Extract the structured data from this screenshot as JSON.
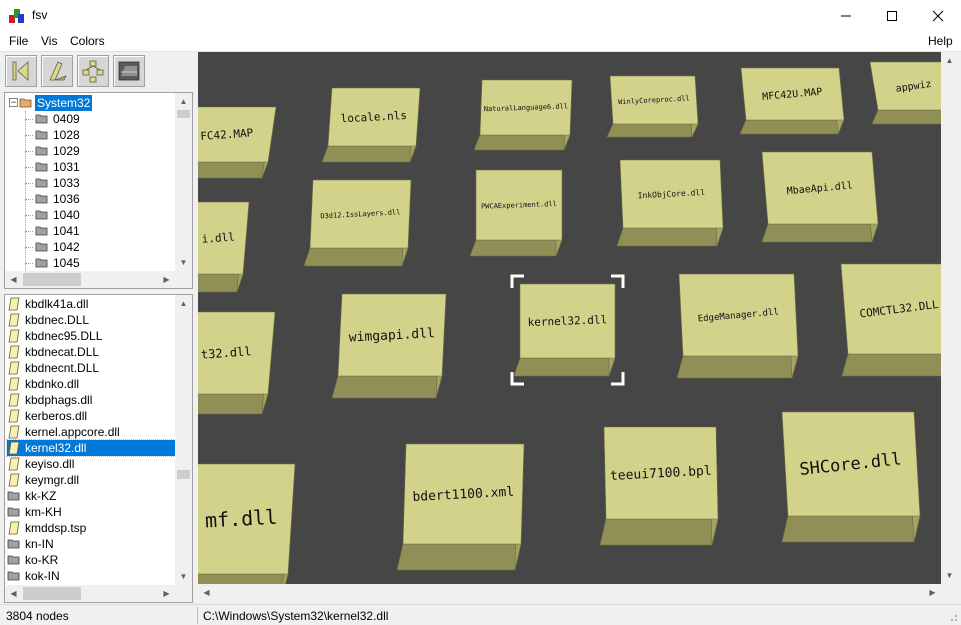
{
  "window": {
    "title": "fsv"
  },
  "menu": {
    "file": "File",
    "vis": "Vis",
    "colors": "Colors",
    "help": "Help"
  },
  "toolbar": {
    "icons": [
      "back-to-root-icon",
      "birdseye-view-icon",
      "cd-up-icon",
      "toggle-view-icon"
    ]
  },
  "tree": {
    "root": "System32",
    "children": [
      "0409",
      "1028",
      "1029",
      "1031",
      "1033",
      "1036",
      "1040",
      "1041",
      "1042",
      "1045"
    ]
  },
  "files": [
    "kbdlk41a.dll",
    "kbdnec.DLL",
    "kbdnec95.DLL",
    "kbdnecat.DLL",
    "kbdnecnt.DLL",
    "kbdnko.dll",
    "kbdphags.dll",
    "kerberos.dll",
    "kernel.appcore.dll",
    "kernel32.dll",
    "keyiso.dll",
    "keymgr.dll",
    "kk-KZ",
    "km-KH",
    "kmddsp.tsp",
    "kn-IN",
    "ko-KR",
    "kok-IN"
  ],
  "selected_file": "kernel32.dll",
  "scene": {
    "blocks": [
      "FC42.MAP",
      "locale.nls",
      "NaturalLanguage6.dll",
      "WinlyCoreproc.dll",
      "MFC42U.MAP",
      "appwiz",
      "i.dll",
      "D3d12.IssLayers.dll",
      "PWCAExperiment.dll",
      "InkObjCore.dll",
      "MbaeApi.dll",
      "t32.dll",
      "wimgapi.dll",
      "kernel32.dll",
      "EdgeManager.dll",
      "COMCTL32.DLL",
      "mf.dll",
      "bdert1100.xml",
      "teeui7100.bpl",
      "SHCore.dll"
    ]
  },
  "status": {
    "node_count": "3804 nodes",
    "path": "C:\\Windows\\System32\\kernel32.dll"
  },
  "colors": {
    "block_top": "#d2d28b",
    "block_side": "#a3a366",
    "block_front": "#8f8f56",
    "ground": "#464646",
    "selection": "#0078d7"
  }
}
